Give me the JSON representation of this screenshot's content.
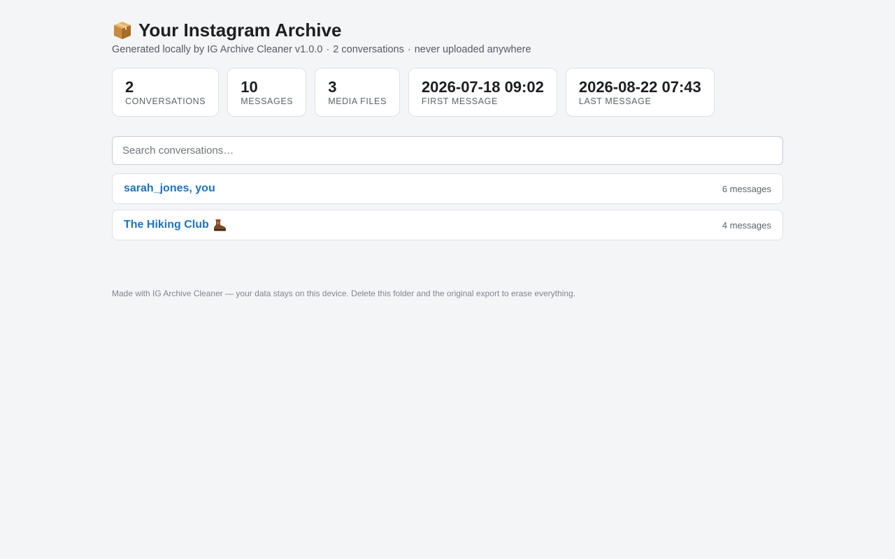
{
  "header": {
    "title": "Your Instagram Archive",
    "subtitle_parts": [
      "Generated locally by IG Archive Cleaner v1.0.0",
      "2 conversations",
      "never uploaded anywhere"
    ],
    "separator": "·",
    "icon": "package-icon"
  },
  "stats": [
    {
      "value": "2",
      "label": "Conversations"
    },
    {
      "value": "10",
      "label": "Messages"
    },
    {
      "value": "3",
      "label": "Media files"
    },
    {
      "value": "2026-07-18 09:02",
      "label": "First message"
    },
    {
      "value": "2026-08-22 07:43",
      "label": "Last message"
    }
  ],
  "search": {
    "placeholder": "Search conversations…"
  },
  "conversations": [
    {
      "name": "sarah_jones, you",
      "count": "6 messages",
      "icon": ""
    },
    {
      "name": "The Hiking Club",
      "count": "4 messages",
      "icon": "hiking-boot-icon"
    }
  ],
  "footer": {
    "text": "Made with IG Archive Cleaner — your data stays on this device. Delete this folder and the original export to erase everything."
  },
  "colors": {
    "background": "#f4f5f7",
    "link": "#1a73c8",
    "card_border": "#dde0e4"
  }
}
